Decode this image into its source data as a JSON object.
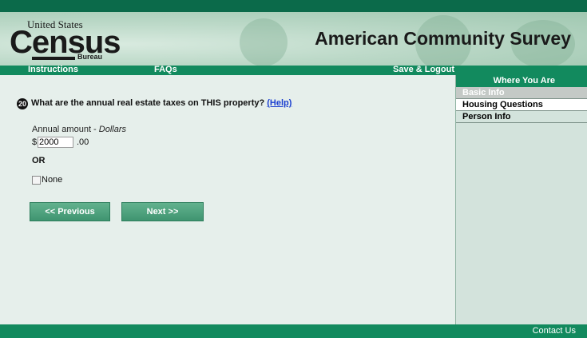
{
  "header": {
    "logo_top": "United States",
    "logo_main": "Census",
    "logo_bottom": "Bureau",
    "title": "American Community Survey"
  },
  "nav": {
    "instructions": "Instructions",
    "faqs": "FAQs",
    "save_logout": "Save & Logout"
  },
  "sidebar": {
    "heading": "Where You Are",
    "items": [
      {
        "label": "Basic Info",
        "state": "disabled"
      },
      {
        "label": "Housing Questions",
        "state": "current"
      },
      {
        "label": "Person Info",
        "state": "link"
      }
    ]
  },
  "question": {
    "number": "20",
    "text": "What are the annual real estate taxes on THIS property?",
    "help_link": "(Help)",
    "amount_label": "Annual amount - ",
    "amount_unit": "Dollars",
    "currency_symbol": "$",
    "amount_value": "2000",
    "cents": ".00",
    "or_text": "OR",
    "none_label": "None",
    "none_checked": false
  },
  "buttons": {
    "previous": "<<  Previous",
    "next": "Next  >>"
  },
  "footer": {
    "contact": "Contact Us"
  },
  "colors": {
    "brand_dark": "#0b6a4a",
    "brand": "#128a5e",
    "panel": "#e6efeb",
    "sidebar": "#d3e3dc",
    "link": "#1a3fd0"
  }
}
